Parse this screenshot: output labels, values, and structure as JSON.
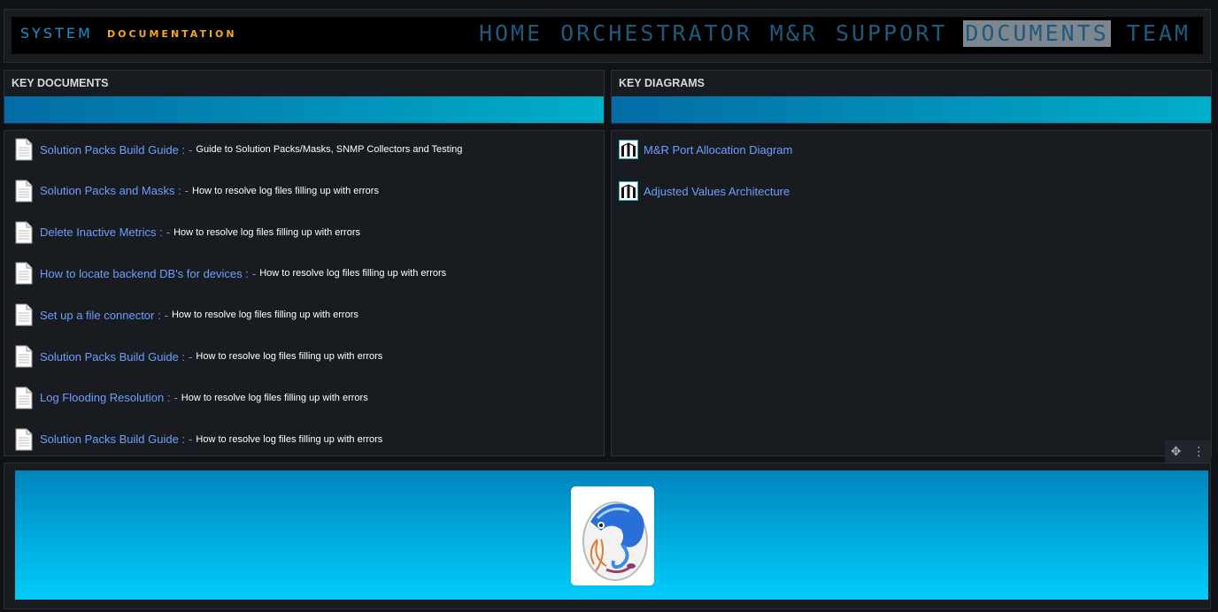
{
  "header": {
    "brand_main": "SYSTEM",
    "brand_sub": "DOCUMENTATION",
    "nav": [
      {
        "label": "HOME",
        "active": false
      },
      {
        "label": "ORCHESTRATOR",
        "active": false
      },
      {
        "label": "M&R",
        "active": false
      },
      {
        "label": "SUPPORT",
        "active": false
      },
      {
        "label": "DOCUMENTS",
        "active": true
      },
      {
        "label": "TEAM",
        "active": false
      }
    ]
  },
  "key_documents": {
    "title": "KEY DOCUMENTS",
    "separator": "-",
    "items": [
      {
        "link": "Solution Packs Build Guide :",
        "desc": "Guide to Solution Packs/Masks, SNMP Collectors and Testing",
        "icon": "document-icon"
      },
      {
        "link": "Solution Packs and Masks :",
        "desc": "How to resolve log files filling up with errors",
        "icon": "document-icon"
      },
      {
        "link": "Delete Inactive Metrics :",
        "desc": "How to resolve log files filling up with errors",
        "icon": "document-icon"
      },
      {
        "link": "How to locate backend DB's for devices :",
        "desc": "How to resolve log files filling up with errors",
        "icon": "document-icon"
      },
      {
        "link": "Set up a file connector :",
        "desc": "How to resolve log files filling up with errors",
        "icon": "document-icon"
      },
      {
        "link": "Solution Packs Build Guide :",
        "desc": "How to resolve log files filling up with errors",
        "icon": "document-icon"
      },
      {
        "link": "Log Flooding Resolution :",
        "desc": "How to resolve log files filling up with errors",
        "icon": "document-icon"
      },
      {
        "link": "Solution Packs Build Guide :",
        "desc": "How to resolve log files filling up with errors",
        "icon": "document-icon"
      }
    ]
  },
  "key_diagrams": {
    "title": "KEY DIAGRAMS",
    "items": [
      {
        "link": "M&R Port Allocation Diagram",
        "icon": "diagram-icon"
      },
      {
        "link": "Adjusted Values Architecture",
        "icon": "diagram-icon"
      }
    ]
  },
  "panel_controls": {
    "move_icon": "move-icon",
    "menu_icon": "kebab-menu-icon"
  },
  "footer": {
    "logo": "chameleon-logo"
  },
  "colors": {
    "accent_blue": "#1e8fd0",
    "accent_orange": "#f5a623",
    "link": "#6e9fff",
    "bar_start": "#036ca6",
    "bar_end": "#01aec8"
  }
}
